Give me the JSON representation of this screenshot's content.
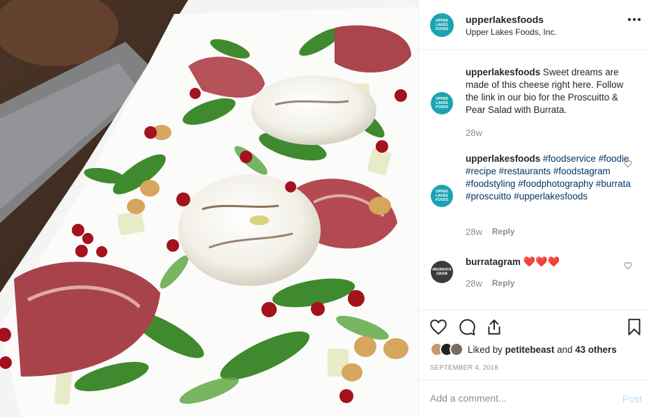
{
  "photo": {
    "alt_subject": "burrata-salad-photo"
  },
  "header": {
    "avatar_text": "UPPER LAKES FOODS",
    "username": "upperlakesfoods",
    "subtitle": "Upper Lakes Foods, Inc."
  },
  "comments": [
    {
      "username": "upperlakesfoods",
      "text": "Sweet dreams are made of this cheese right here. Follow the link in our bio for the Proscuitto & Pear Salad with Burrata.",
      "time": "28w"
    },
    {
      "username": "upperlakesfoods",
      "tags": [
        "#foodservice",
        "#foodie",
        "#recipe",
        "#restaurants",
        "#foodstagram",
        "#foodstyling",
        "#foodphotography",
        "#burrata",
        "#proscuitto",
        "#upperlakesfoods"
      ],
      "time": "28w",
      "reply_label": "Reply"
    },
    {
      "username": "burratagram",
      "avatar_text": "#BURRATA GRAM",
      "emoji": "❤️❤️❤️",
      "time": "28w",
      "reply_label": "Reply"
    }
  ],
  "likes": {
    "prefix": "Liked by",
    "user": "petitebeast",
    "connector": "and",
    "others": "43 others"
  },
  "date": "SEPTEMBER 4, 2018",
  "add_comment": {
    "placeholder": "Add a comment...",
    "post_label": "Post"
  },
  "colors": {
    "brand_teal": "#1aa3b2",
    "post_disabled": "#b2dffc",
    "hashtag": "#003569",
    "heart_red": "#ed1c24"
  },
  "icons": [
    "heart-icon",
    "comment-icon",
    "share-icon",
    "bookmark-icon",
    "more-icon"
  ]
}
